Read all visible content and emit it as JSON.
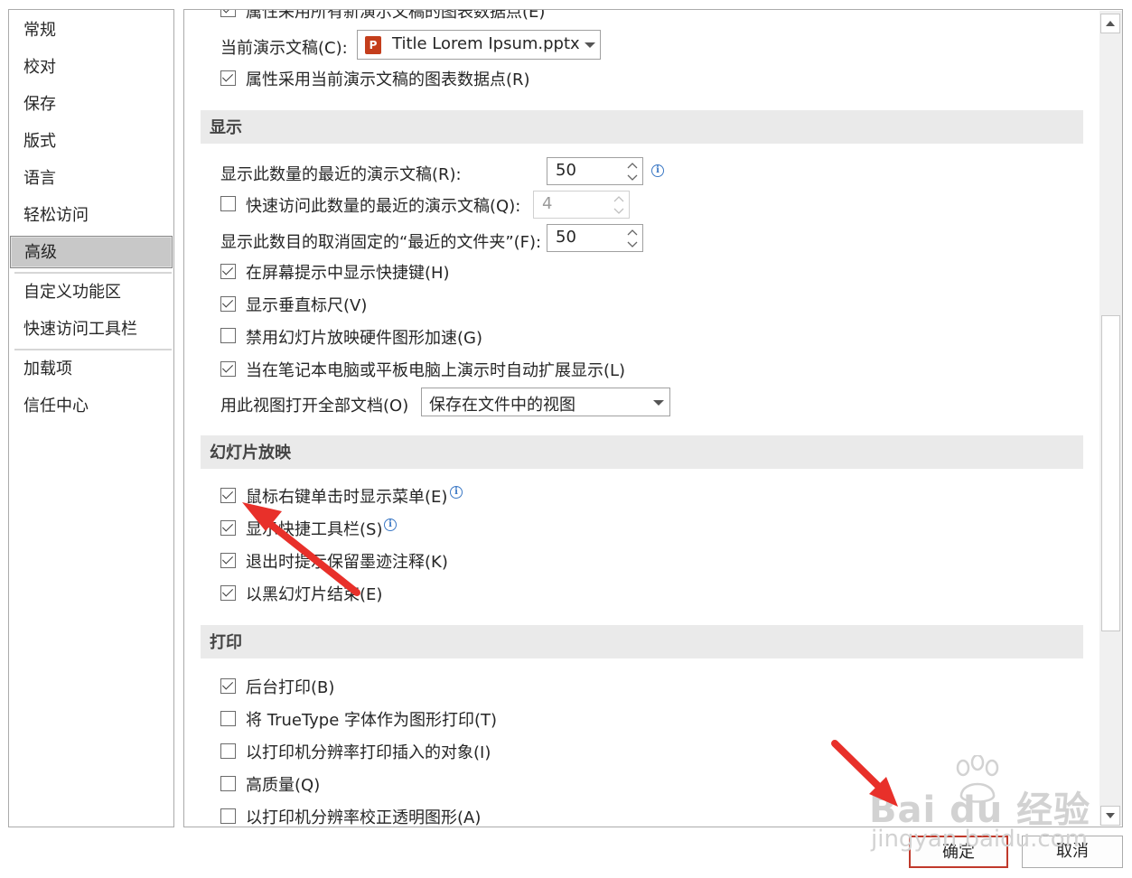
{
  "nav": {
    "items": [
      "常规",
      "校对",
      "保存",
      "版式",
      "语言",
      "轻松访问",
      "高级",
      "自定义功能区",
      "快速访问工具栏",
      "加载项",
      "信任中心"
    ],
    "selected": "高级"
  },
  "top": {
    "cut_text": "属性采用所有新演示文稿的图表数据点(E)",
    "current_pres_label": "当前演示文稿(C):",
    "current_pres_value": "Title Lorem Ipsum.pptx",
    "chart_props_label": "属性采用当前演示文稿的图表数据点(R)"
  },
  "display": {
    "header": "显示",
    "recent_count_label": "显示此数量的最近的演示文稿(R):",
    "recent_count_value": "50",
    "quick_access_label": "快速访问此数量的最近的演示文稿(Q):",
    "quick_access_value": "4",
    "unpinned_label": "显示此数目的取消固定的“最近的文件夹”(F):",
    "unpinned_value": "50",
    "shortcut_keys_label": "在屏幕提示中显示快捷键(H)",
    "vertical_ruler_label": "显示垂直标尺(V)",
    "hw_accel_label": "禁用幻灯片放映硬件图形加速(G)",
    "auto_extend_label": "当在笔记本电脑或平板电脑上演示时自动扩展显示(L)",
    "open_view_label": "用此视图打开全部文档(O)",
    "open_view_value": "保存在文件中的视图"
  },
  "slideshow": {
    "header": "幻灯片放映",
    "right_click_menu_label": "鼠标右键单击时显示菜单(E)",
    "popup_toolbar_label": "显示快捷工具栏(S)",
    "keep_ink_label": "退出时提示保留墨迹注释(K)",
    "end_black_label": "以黑幻灯片结束(E)"
  },
  "print": {
    "header": "打印",
    "background_print_label": "后台打印(B)",
    "truetype_label": "将 TrueType 字体作为图形打印(T)",
    "printer_res_label": "以打印机分辨率打印插入的对象(I)",
    "high_quality_label": "高质量(Q)",
    "align_transparent_label": "以打印机分辨率校正透明图形(A)"
  },
  "footer": {
    "ok_label": "确定",
    "cancel_label": "取消"
  },
  "watermark": {
    "brand": "Bai du 经验",
    "url": "jingyan.baidu.com"
  },
  "colors": {
    "accent_arrow": "#e8302a",
    "section_bg": "#eaeaea",
    "info_icon": "#3b78c5",
    "ok_border": "#c0392b"
  }
}
